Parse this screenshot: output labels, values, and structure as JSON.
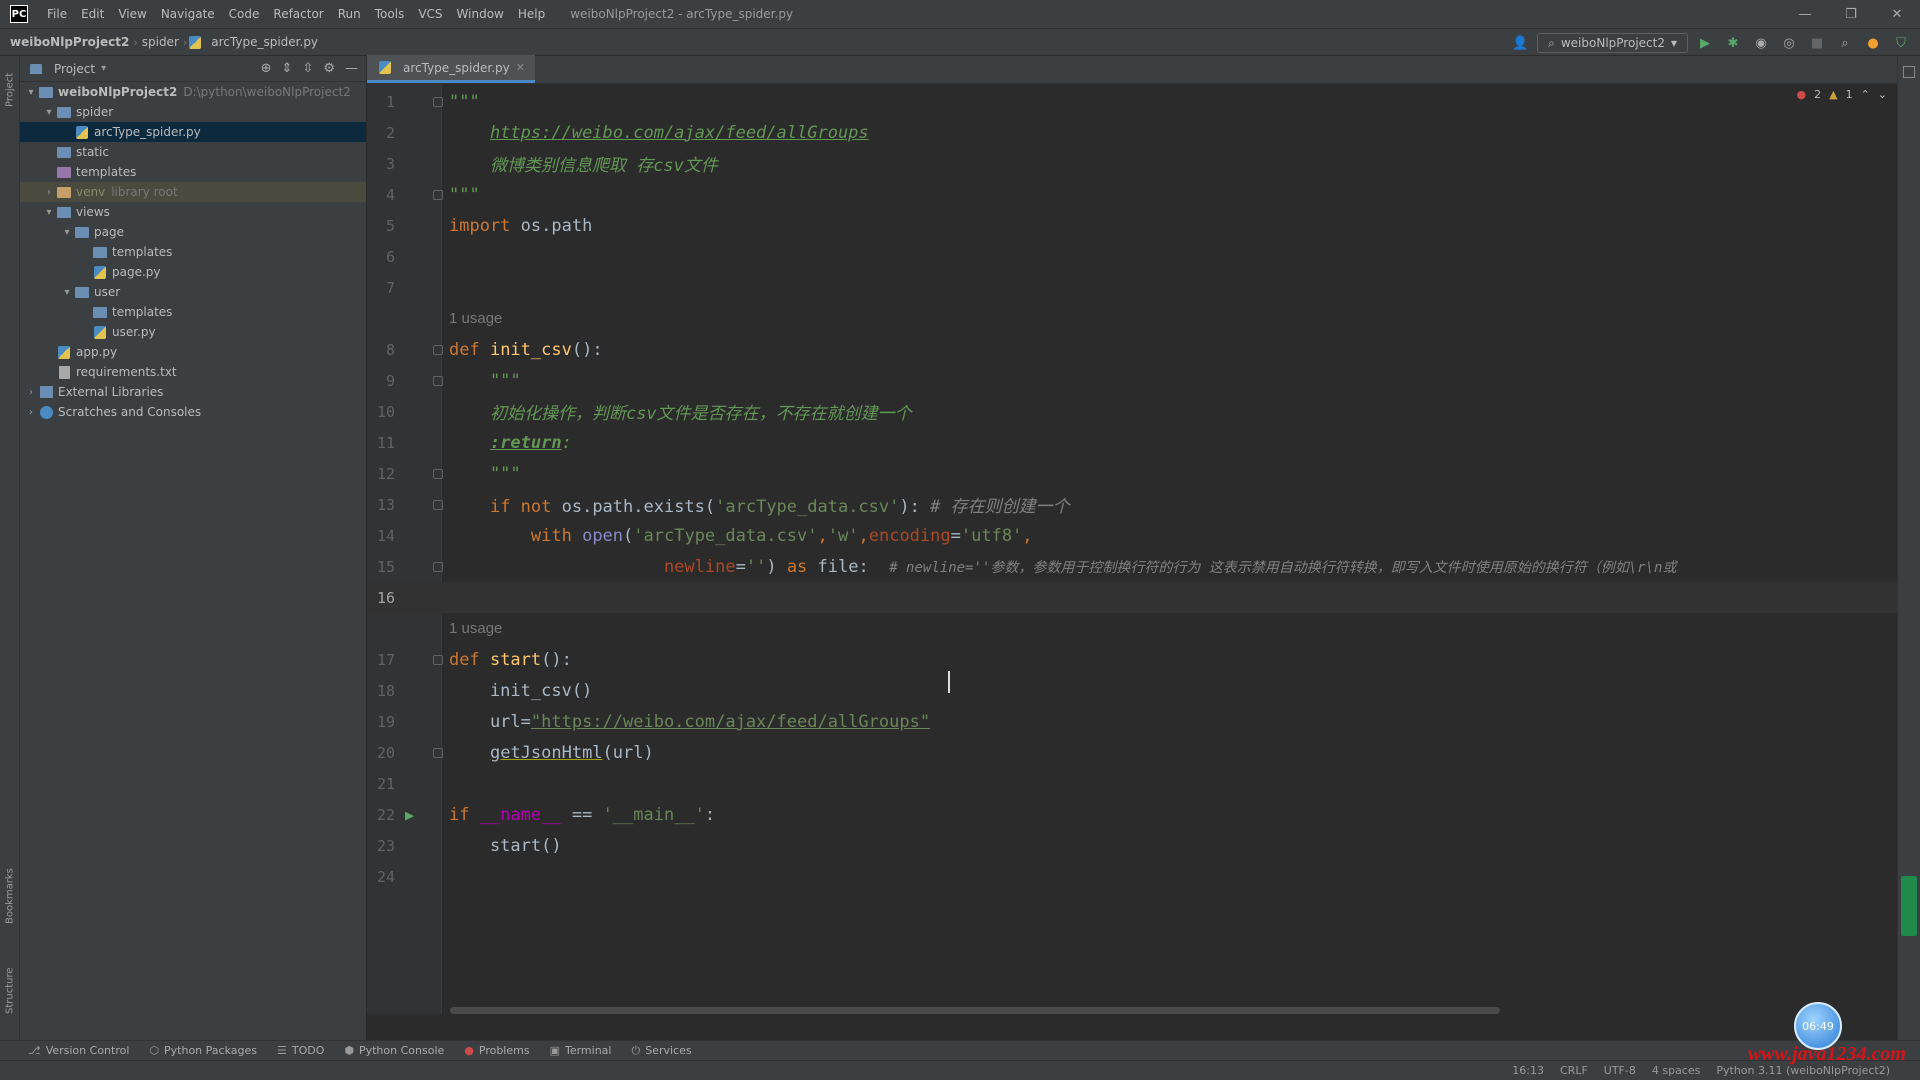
{
  "menubar": {
    "logo": "PC",
    "items": [
      "File",
      "Edit",
      "View",
      "Navigate",
      "Code",
      "Refactor",
      "Run",
      "Tools",
      "VCS",
      "Window",
      "Help"
    ],
    "window_title": "weiboNlpProject2 - arcType_spider.py",
    "controls": [
      "—",
      "❐",
      "✕"
    ]
  },
  "navbar": {
    "crumbs": [
      "weiboNlpProject2",
      "spider",
      "arcType_spider.py"
    ],
    "run_config": "weiboNlpProject2"
  },
  "project_panel": {
    "title": "Project",
    "tree": [
      {
        "label": "weiboNlpProject2",
        "hint": "D:\\python\\weiboNlpProject2",
        "level": 0,
        "arrow": "▾",
        "icon": "folder"
      },
      {
        "label": "spider",
        "level": 1,
        "arrow": "▾",
        "icon": "folder"
      },
      {
        "label": "arcType_spider.py",
        "level": 2,
        "arrow": "",
        "icon": "py",
        "selected": true
      },
      {
        "label": "static",
        "level": 1,
        "arrow": "",
        "icon": "folder"
      },
      {
        "label": "templates",
        "level": 1,
        "arrow": "",
        "icon": "folder-purple"
      },
      {
        "label": "venv",
        "hint": "library root",
        "level": 1,
        "arrow": "›",
        "icon": "folder-excl",
        "excluded": true
      },
      {
        "label": "views",
        "level": 1,
        "arrow": "▾",
        "icon": "folder"
      },
      {
        "label": "page",
        "level": 2,
        "arrow": "▾",
        "icon": "folder"
      },
      {
        "label": "templates",
        "level": 3,
        "arrow": "",
        "icon": "folder"
      },
      {
        "label": "page.py",
        "level": 3,
        "arrow": "",
        "icon": "py"
      },
      {
        "label": "user",
        "level": 2,
        "arrow": "▾",
        "icon": "folder"
      },
      {
        "label": "templates",
        "level": 3,
        "arrow": "",
        "icon": "folder"
      },
      {
        "label": "user.py",
        "level": 3,
        "arrow": "",
        "icon": "py"
      },
      {
        "label": "app.py",
        "level": 1,
        "arrow": "",
        "icon": "py"
      },
      {
        "label": "requirements.txt",
        "level": 1,
        "arrow": "",
        "icon": "txt"
      },
      {
        "label": "External Libraries",
        "level": 0,
        "arrow": "›",
        "icon": "lib"
      },
      {
        "label": "Scratches and Consoles",
        "level": 0,
        "arrow": "›",
        "icon": "scratch"
      }
    ]
  },
  "editor_tab": {
    "label": "arcType_spider.py"
  },
  "inspection": {
    "errors": "2",
    "warnings": "1"
  },
  "code": {
    "usage_hint": "1 usage",
    "l2_url": "https://weibo.com/ajax/feed/allGroups",
    "l3_doc": "微博类别信息爬取 存csv文件",
    "l10_doc": "初始化操作，判断csv文件是否存在，不存在就创建一个",
    "l11_doc": ":return",
    "l13_str": "'arcType_data.csv'",
    "l13_com": "# 存在则创建一个",
    "l14_s1": "'arcType_data.csv'",
    "l14_s2": "'w'",
    "l14_s3": "'utf8'",
    "l15_s": "''",
    "l15_com": "# newline=''参数，参数用于控制换行符的行为 这表示禁用自动换行符转换，即写入文件时使用原始的换行符（例如\\r\\n或",
    "l19_url": "\"https://weibo.com/ajax/feed/allGroups\"",
    "l22_str": "'__main__'"
  },
  "bottom_tools": [
    {
      "icon": "⎇",
      "label": "Version Control"
    },
    {
      "icon": "⬡",
      "label": "Python Packages"
    },
    {
      "icon": "☰",
      "label": "TODO"
    },
    {
      "icon": "⬢",
      "label": "Python Console"
    },
    {
      "icon": "●",
      "label": "Problems"
    },
    {
      "icon": "▣",
      "label": "Terminal"
    },
    {
      "icon": "⏻",
      "label": "Services"
    }
  ],
  "statusbar": [
    "16:13",
    "CRLF",
    "UTF-8",
    "4 spaces",
    "Python 3.11 (weiboNlpProject2)"
  ],
  "left_stripe": [
    "Project",
    "Bookmarks",
    "Structure"
  ],
  "watermark": "www.java1234.com",
  "float_badge": "06:49"
}
